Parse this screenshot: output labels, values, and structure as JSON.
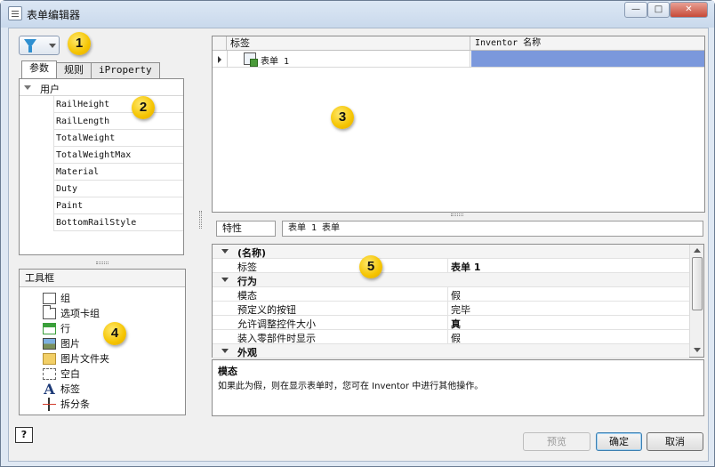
{
  "window": {
    "title": "表单编辑器",
    "controls": {
      "minimize": "—",
      "maximize": "□",
      "close": "✕"
    }
  },
  "left": {
    "tabs": [
      "参数",
      "规则",
      "iProperty"
    ],
    "active_tab": 0,
    "param_group": "用户",
    "params": [
      "RailHeight",
      "RailLength",
      "TotalWeight",
      "TotalWeightMax",
      "Material",
      "Duty",
      "Paint",
      "BottomRailStyle"
    ],
    "toolbox": {
      "title": "工具框",
      "items": [
        {
          "label": "组",
          "icon": "group-box-icon"
        },
        {
          "label": "选项卡组",
          "icon": "tab-group-icon"
        },
        {
          "label": "行",
          "icon": "row-icon"
        },
        {
          "label": "图片",
          "icon": "picture-icon"
        },
        {
          "label": "图片文件夹",
          "icon": "picture-folder-icon"
        },
        {
          "label": "空白",
          "icon": "blank-space-icon"
        },
        {
          "label": "标签",
          "icon": "label-icon"
        },
        {
          "label": "拆分条",
          "icon": "splitter-icon"
        }
      ]
    }
  },
  "tree_grid": {
    "columns": [
      "标签",
      "Inventor 名称"
    ],
    "rows": [
      {
        "label": "表单 1",
        "inventor_name": ""
      }
    ]
  },
  "properties": {
    "label": "特性",
    "value": "表单 1 表单",
    "rows": [
      {
        "type": "category",
        "name": "(名称)"
      },
      {
        "type": "prop",
        "name": "标签",
        "value": "表单 1",
        "bold": true
      },
      {
        "type": "category",
        "name": "行为"
      },
      {
        "type": "prop",
        "name": "模态",
        "value": "假",
        "bold": false
      },
      {
        "type": "prop",
        "name": "预定义的按钮",
        "value": "完毕",
        "bold": false
      },
      {
        "type": "prop",
        "name": "允许调整控件大小",
        "value": "真",
        "bold": true
      },
      {
        "type": "prop",
        "name": "装入零部件时显示",
        "value": "假",
        "bold": false
      },
      {
        "type": "category",
        "name": "外观"
      }
    ],
    "description_title": "模态",
    "description_text": "如果此为假，则在显示表单时，您可在 Inventor 中进行其他操作。"
  },
  "footer": {
    "help": "?",
    "preview": "预览",
    "ok": "确定",
    "cancel": "取消"
  },
  "badges": [
    "1",
    "2",
    "3",
    "4",
    "5"
  ],
  "colors": {
    "selection": "#7b98dc",
    "badge": "#f5c400"
  }
}
